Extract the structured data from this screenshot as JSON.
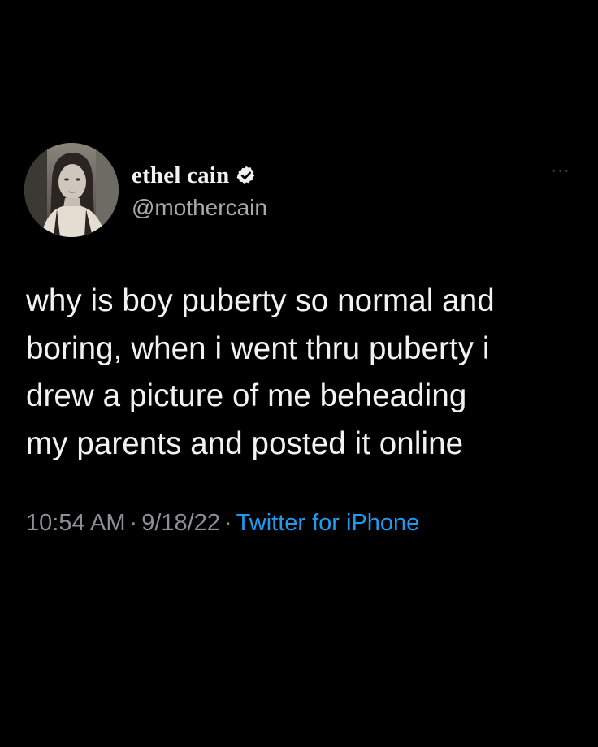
{
  "author": {
    "display_name": "ethel cain",
    "handle": "@mothercain",
    "verified": true,
    "avatar_icon": "profile-photo"
  },
  "menu": {
    "more_label": "···"
  },
  "tweet": {
    "text": "why is boy puberty so normal and\nboring, when i went thru puberty i\ndrew a picture of me beheading\nmy parents and posted it online",
    "time": "10:54 AM",
    "date": "9/18/22",
    "separator": "·",
    "source": "Twitter for iPhone"
  },
  "colors": {
    "background": "#000000",
    "text": "#f2f2f2",
    "secondary": "#8b8f94",
    "link": "#1d9bf0"
  }
}
